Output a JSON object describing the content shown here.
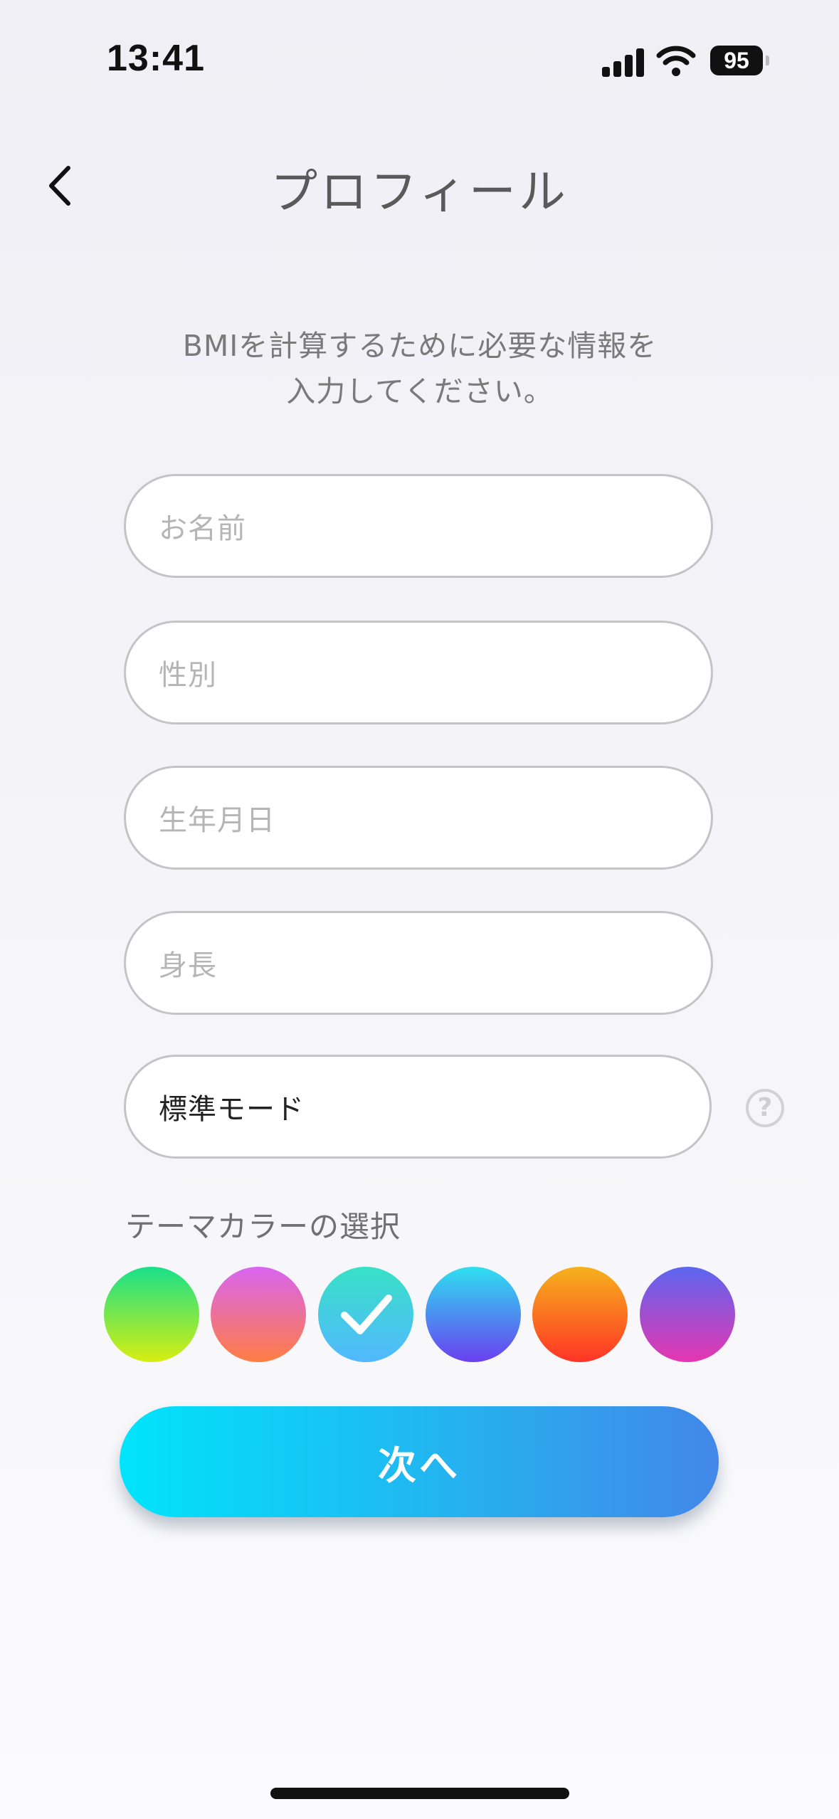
{
  "status_bar": {
    "time": "13:41",
    "battery_level": "95",
    "icons": [
      "signal-icon",
      "wifi-icon",
      "battery-icon"
    ]
  },
  "nav": {
    "back_icon": "chevron-left-icon",
    "title": "プロフィール"
  },
  "description": {
    "line1": "BMIを計算するために必要な情報を",
    "line2": "入力してください。"
  },
  "fields": {
    "name_placeholder": "お名前",
    "gender_placeholder": "性別",
    "birthday_placeholder": "生年月日",
    "height_placeholder": "身長",
    "mode_value": "標準モード",
    "help_icon": "question-circle-icon",
    "help_glyph": "?"
  },
  "theme": {
    "label": "テーマカラーの選択",
    "selected_index": 2,
    "swatches": [
      {
        "from": "#18e08a",
        "to": "#d8ee10"
      },
      {
        "from": "#d865f0",
        "to": "#ff7d43"
      },
      {
        "from": "#37e1c6",
        "to": "#52b8ff"
      },
      {
        "from": "#2ee0f0",
        "to": "#6a3ff0"
      },
      {
        "from": "#f6b21c",
        "to": "#ff3426"
      },
      {
        "from": "#5c66f0",
        "to": "#e636b0"
      }
    ]
  },
  "actions": {
    "next_label": "次へ"
  },
  "colors": {
    "accent_start": "#00e4fb",
    "accent_end": "#4287e8"
  }
}
